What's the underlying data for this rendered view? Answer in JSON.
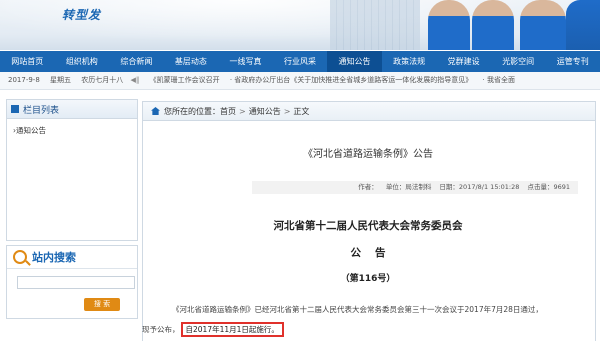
{
  "banner": {
    "slogan": "转型发"
  },
  "nav": {
    "items": [
      "网站首页",
      "组织机构",
      "综合新闻",
      "基层动态",
      "一线写真",
      "行业风采",
      "通知公告",
      "政策法规",
      "党群建设",
      "光影空间",
      "运管专刊"
    ],
    "active_index": 6
  },
  "ticker": {
    "date": "2017-9-8",
    "weekday": "星期五",
    "lunar": "农历七月十八",
    "items": [
      "《凯蒙珊工作会议召开",
      "· 省政府办公厅出台《关于加快推进全省城乡道路客运一体化发展的指导意见》",
      "· 我省全面"
    ]
  },
  "sidebar": {
    "column_title": "栏目列表",
    "links": [
      "通知公告"
    ],
    "search_title": "站内搜索",
    "search_button": "搜 索"
  },
  "breadcrumb": {
    "prefix": "您所在的位置：",
    "home": "首页",
    "section": "通知公告",
    "current": "正文",
    "sep": ">"
  },
  "article": {
    "title": "《河北省道路运输条例》公告",
    "meta": {
      "author": "作者：",
      "unit": "单位：局法制科",
      "date": "日期：2017/8/1 15:01:28",
      "hits": "点击量：9691"
    },
    "heading": "河北省第十二届人民代表大会常务委员会",
    "subheading": "公告",
    "number": "（第116号）",
    "para1": "《河北省道路运输条例》已经河北省第十二届人民代表大会常务委员会第三十一次会议于2017年7月28日通过，",
    "para2_lead": "现予公布，",
    "para2_highlight": "自2017年11月1日起施行。"
  }
}
